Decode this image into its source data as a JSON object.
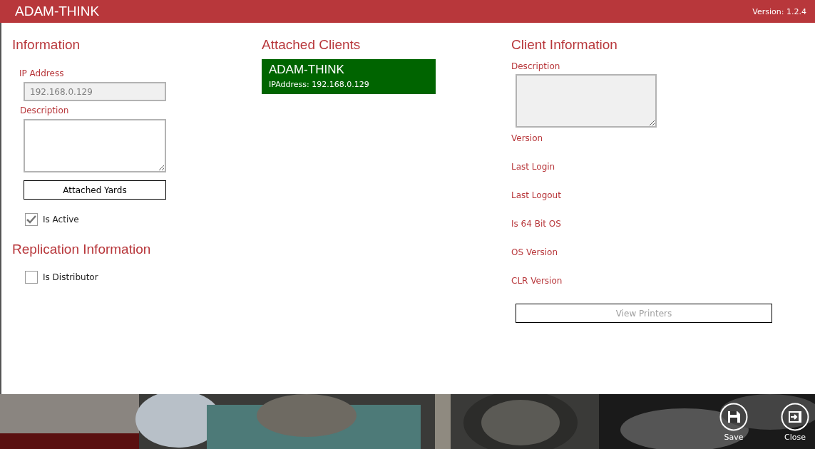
{
  "window": {
    "title": "ADAM-THINK",
    "version": "Version: 1.2.4"
  },
  "information": {
    "heading": "Information",
    "ip_field": {
      "label": "IP Address",
      "value": "192.168.0.129",
      "disabled": true
    },
    "description_field": {
      "label": "Description",
      "disabled": false
    },
    "attached_yards_button": {
      "label": "Attached Yards",
      "disabled": false
    },
    "is_active": {
      "label": "Is Active",
      "checked": true
    }
  },
  "replication": {
    "heading": "Replication Information",
    "is_distributor": {
      "label": "Is Distributor",
      "checked": false
    }
  },
  "attached_clients": {
    "heading": "Attached Clients",
    "items": [
      {
        "name": "ADAM-THINK",
        "detail": "IPAddress: 192.168.0.129",
        "selected": true
      }
    ]
  },
  "client_information": {
    "heading": "Client Information",
    "description_field": {
      "label": "Description",
      "disabled": true
    },
    "labels": [
      "Version",
      "Last Login",
      "Last Logout",
      "Is 64 Bit OS",
      "OS Version",
      "CLR Version"
    ],
    "view_printers_button": {
      "label": "View Printers",
      "disabled": true
    }
  },
  "footer": {
    "kind": "picture",
    "actions": [
      {
        "kind": "save",
        "label": "Save"
      },
      {
        "kind": "close",
        "label": "Close"
      }
    ]
  }
}
